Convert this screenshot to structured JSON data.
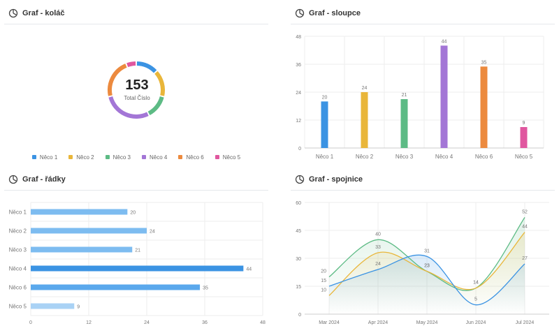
{
  "panels": {
    "pie": {
      "title": "Graf - koláč"
    },
    "bar": {
      "title": "Graf - sloupce"
    },
    "hbar": {
      "title": "Graf - řádky"
    },
    "line": {
      "title": "Graf - spojnice"
    }
  },
  "donut": {
    "total": "153",
    "total_label": "Total Číslo"
  },
  "colors": {
    "blue": "#3b93e3",
    "yellow": "#e9b63a",
    "green": "#5dbb85",
    "purple": "#a376d6",
    "orange": "#ec8a3e",
    "pink": "#e0579f",
    "grid": "#eeeeee",
    "axis": "#cccccc"
  },
  "chart_data": [
    {
      "type": "pie",
      "title": "Graf - koláč",
      "categories": [
        "Něco 1",
        "Něco 2",
        "Něco 3",
        "Něco 4",
        "Něco 6",
        "Něco 5"
      ],
      "values": [
        20,
        24,
        21,
        44,
        35,
        9
      ],
      "colors": [
        "#3b93e3",
        "#e9b63a",
        "#5dbb85",
        "#a376d6",
        "#ec8a3e",
        "#e0579f"
      ],
      "legend": "bottom",
      "center_text": "153",
      "center_label": "Total Číslo"
    },
    {
      "type": "bar",
      "title": "Graf - sloupce",
      "categories": [
        "Něco 1",
        "Něco 2",
        "Něco 3",
        "Něco 4",
        "Něco 6",
        "Něco 5"
      ],
      "values": [
        20,
        24,
        21,
        44,
        35,
        9
      ],
      "colors": [
        "#3b93e3",
        "#e9b63a",
        "#5dbb85",
        "#a376d6",
        "#ec8a3e",
        "#e0579f"
      ],
      "ylim": [
        0,
        48
      ],
      "yticks": [
        0,
        12,
        24,
        36,
        48
      ],
      "grid": true
    },
    {
      "type": "bar",
      "orientation": "horizontal",
      "title": "Graf - řádky",
      "categories": [
        "Něco 1",
        "Něco 2",
        "Něco 3",
        "Něco 4",
        "Něco 6",
        "Něco 5"
      ],
      "values": [
        20,
        24,
        21,
        44,
        35,
        9
      ],
      "colors": [
        "#7dbcf0",
        "#7dbcf0",
        "#7dbcf0",
        "#3b93e3",
        "#5aa8ec",
        "#a9d2f5"
      ],
      "xlim": [
        0,
        48
      ],
      "xticks": [
        0,
        12,
        24,
        36,
        48
      ],
      "grid": true
    },
    {
      "type": "line",
      "title": "Graf - spojnice",
      "categories": [
        "Mar 2024",
        "Apr 2024",
        "May 2024",
        "Jun 2024",
        "Jul 2024"
      ],
      "ylim": [
        0,
        60
      ],
      "yticks": [
        0,
        15,
        30,
        45,
        60
      ],
      "grid": true,
      "series": [
        {
          "values": [
            20,
            40,
            23,
            14,
            52
          ],
          "color": "#5dbb85"
        },
        {
          "values": [
            10,
            33,
            23,
            14,
            44
          ],
          "color": "#e9b63a"
        },
        {
          "values": [
            15,
            24,
            31,
            5,
            27
          ],
          "color": "#3b93e3"
        }
      ]
    }
  ]
}
